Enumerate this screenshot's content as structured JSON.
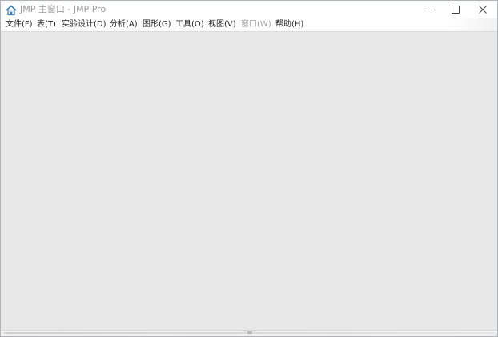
{
  "window": {
    "title": "JMP 主窗口 - JMP Pro",
    "app_icon": "home-icon"
  },
  "caption": {
    "minimize_icon": "minimize-icon",
    "maximize_icon": "maximize-icon",
    "close_icon": "close-icon"
  },
  "menu": {
    "items": [
      {
        "label": "文件(F)",
        "enabled": true
      },
      {
        "label": "表(T)",
        "enabled": true
      },
      {
        "label": "实验设计(D)",
        "enabled": true
      },
      {
        "label": "分析(A)",
        "enabled": true
      },
      {
        "label": "图形(G)",
        "enabled": true
      },
      {
        "label": "工具(O)",
        "enabled": true
      },
      {
        "label": "视图(V)",
        "enabled": true
      },
      {
        "label": "窗口(W)",
        "enabled": false
      },
      {
        "label": "帮助(H)",
        "enabled": true
      }
    ]
  },
  "colors": {
    "workspace": "#e8e8e8",
    "title_text": "#9a9a9a",
    "menu_text": "#222222",
    "menu_disabled": "#9d9d9d"
  }
}
